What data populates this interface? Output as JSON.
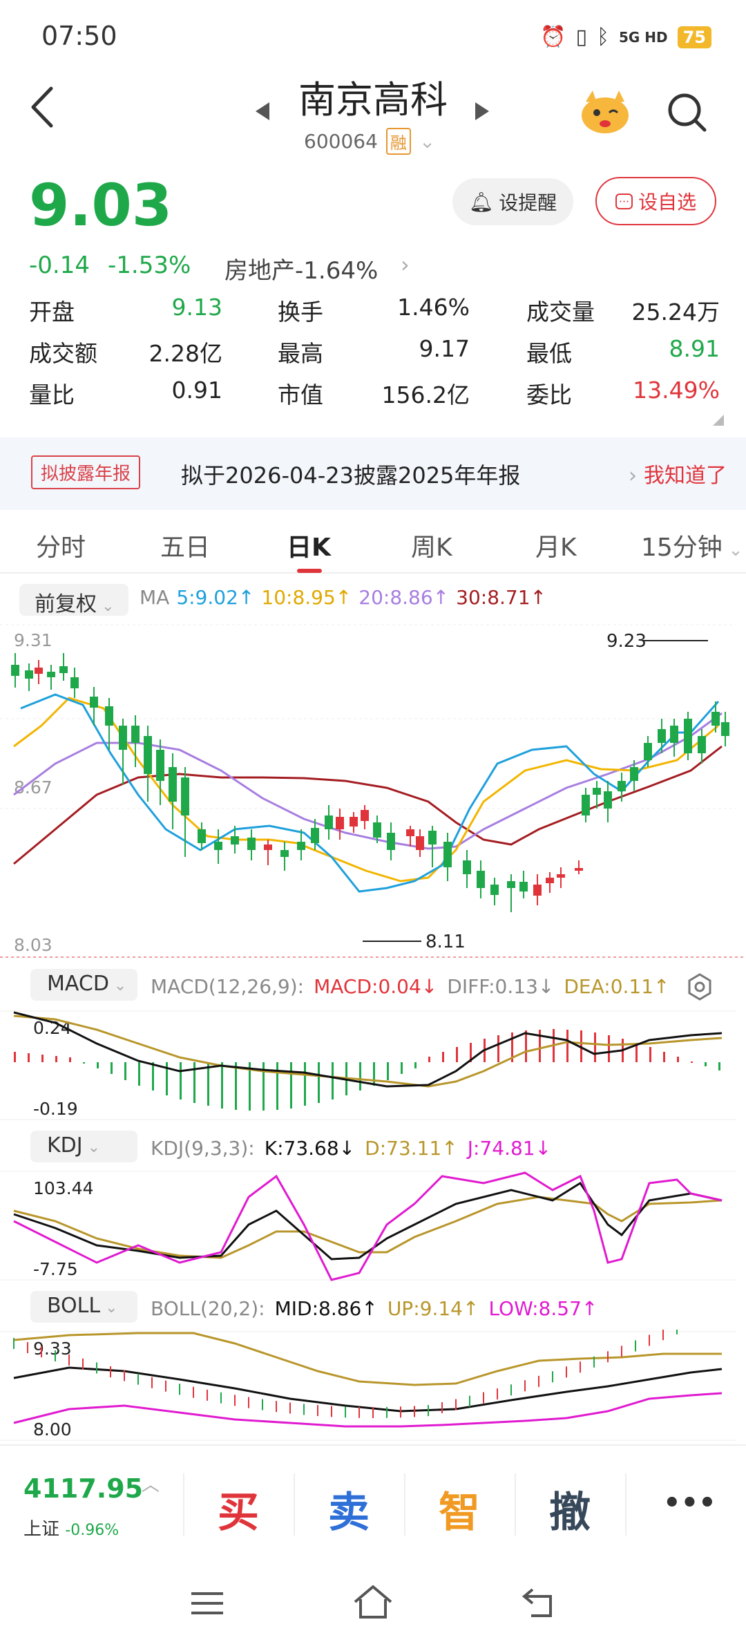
{
  "status": {
    "time": "07:50",
    "battery": "75",
    "network": "5G HD"
  },
  "header": {
    "name": "南京高科",
    "code": "600064",
    "margin_tag": "融"
  },
  "price": {
    "last": "9.03",
    "change": "-0.14",
    "change_pct": "-1.53%",
    "sector": "房地产-1.64%",
    "remind_label": "设提醒",
    "watch_label": "设自选"
  },
  "quote": {
    "open_label": "开盘",
    "open": "9.13",
    "turnover_label": "换手",
    "turnover": "1.46%",
    "volume_label": "成交量",
    "volume": "25.24万",
    "amount_label": "成交额",
    "amount": "2.28亿",
    "high_label": "最高",
    "high": "9.17",
    "low_label": "最低",
    "low": "8.91",
    "vol_ratio_label": "量比",
    "vol_ratio": "0.91",
    "mkt_cap_label": "市值",
    "mkt_cap": "156.2亿",
    "bid_ratio_label": "委比",
    "bid_ratio": "13.49%"
  },
  "notice": {
    "tag": "拟披露年报",
    "text": "拟于2026-04-23披露2025年年报",
    "ack": "我知道了"
  },
  "tabs": [
    "分时",
    "五日",
    "日K",
    "周K",
    "月K",
    "15分钟"
  ],
  "kline": {
    "adjust": "前复权",
    "ma_label": "MA",
    "ma5": "5:9.02↑",
    "ma10": "10:8.95↑",
    "ma20": "20:8.86↑",
    "ma30": "30:8.71↑",
    "y_top": "9.31",
    "y_mid": "8.67",
    "y_bot": "8.03",
    "max_label": "9.23",
    "min_label": "8.11"
  },
  "macd": {
    "btn": "MACD",
    "params": "MACD(12,26,9):",
    "macd": "MACD:0.04↓",
    "diff": "DIFF:0.13↓",
    "dea": "DEA:0.11↑",
    "y_top": "0.24",
    "y_bot": "-0.19"
  },
  "kdj": {
    "btn": "KDJ",
    "params": "KDJ(9,3,3):",
    "k": "K:73.68↓",
    "d": "D:73.11↑",
    "j": "J:74.81↓",
    "y_top": "103.44",
    "y_bot": "-7.75"
  },
  "boll": {
    "btn": "BOLL",
    "params": "BOLL(20,2):",
    "mid": "MID:8.86↑",
    "up": "UP:9.14↑",
    "low": "LOW:8.57↑",
    "y_top": "9.33",
    "y_bot": "8.00"
  },
  "colors": {
    "up": "#e0343b",
    "down": "#1fa84a",
    "ma5": "#1ea0dc",
    "ma10": "#f2b500",
    "ma20": "#a77ee0",
    "ma30": "#a41d22"
  },
  "bottom": {
    "index_value": "4117.95",
    "index_name": "上证",
    "index_change": "-0.96%",
    "buy": "买",
    "sell": "卖",
    "smart": "智",
    "cancel": "撤"
  }
}
